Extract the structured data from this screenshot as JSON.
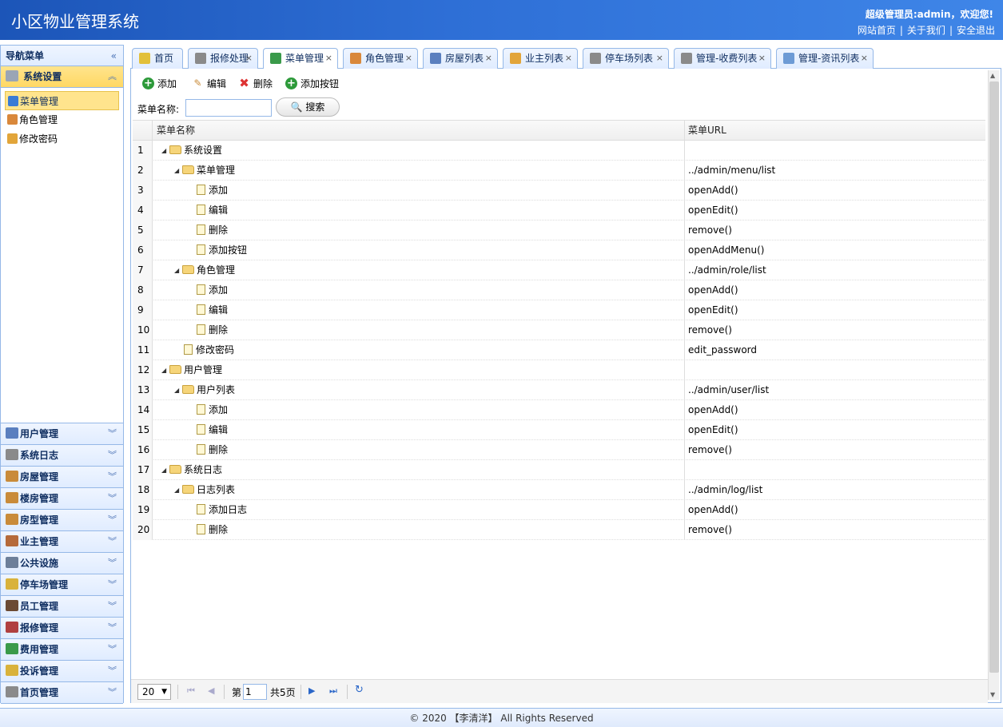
{
  "header": {
    "title": "小区物业管理系统",
    "welcome": "超级管理员:admin，欢迎您!",
    "links": [
      "网站首页",
      "关于我们",
      "安全退出"
    ]
  },
  "nav": {
    "title": "导航菜单",
    "active_group": "系统设置",
    "active_items": [
      {
        "label": "菜单管理",
        "icon": "tree-icon",
        "color": "#3a7bd5"
      },
      {
        "label": "角色管理",
        "icon": "users-icon",
        "color": "#d9883b"
      },
      {
        "label": "修改密码",
        "icon": "lock-icon",
        "color": "#e2a53a"
      }
    ],
    "groups": [
      {
        "label": "用户管理",
        "icon": "user-icon",
        "color": "#5a7fbf"
      },
      {
        "label": "系统日志",
        "icon": "log-icon",
        "color": "#8a8a8a"
      },
      {
        "label": "房屋管理",
        "icon": "house-icon",
        "color": "#c98b3a"
      },
      {
        "label": "楼房管理",
        "icon": "building-icon",
        "color": "#c98b3a"
      },
      {
        "label": "房型管理",
        "icon": "floorplan-icon",
        "color": "#c98b3a"
      },
      {
        "label": "业主管理",
        "icon": "owner-icon",
        "color": "#b56a3a"
      },
      {
        "label": "公共设施",
        "icon": "tools-icon",
        "color": "#6d7f99"
      },
      {
        "label": "停车场管理",
        "icon": "car-icon",
        "color": "#d9b23b"
      },
      {
        "label": "员工管理",
        "icon": "staff-icon",
        "color": "#6b4a33"
      },
      {
        "label": "报修管理",
        "icon": "wrench-icon",
        "color": "#b04040"
      },
      {
        "label": "费用管理",
        "icon": "money-icon",
        "color": "#3a9a4a"
      },
      {
        "label": "投诉管理",
        "icon": "complaint-icon",
        "color": "#d9b23b"
      },
      {
        "label": "首页管理",
        "icon": "home-icon",
        "color": "#8a8a8a"
      }
    ]
  },
  "tabs": [
    {
      "label": "首页",
      "icon": "bulb-icon",
      "color": "#e2c03a",
      "closable": false
    },
    {
      "label": "报修处理",
      "icon": "list-icon",
      "color": "#8a8a8a",
      "closable": true
    },
    {
      "label": "菜单管理",
      "icon": "tree-icon",
      "color": "#3a9a4a",
      "closable": true
    },
    {
      "label": "角色管理",
      "icon": "users-icon",
      "color": "#d9883b",
      "closable": true
    },
    {
      "label": "房屋列表",
      "icon": "house-icon",
      "color": "#5a7fbf",
      "closable": true
    },
    {
      "label": "业主列表",
      "icon": "owner-icon",
      "color": "#e2a53a",
      "closable": true
    },
    {
      "label": "停车场列表",
      "icon": "list-icon",
      "color": "#8a8a8a",
      "closable": true
    },
    {
      "label": "管理-收费列表",
      "icon": "list-icon",
      "color": "#8a8a8a",
      "closable": true
    },
    {
      "label": "管理-资讯列表",
      "icon": "chat-icon",
      "color": "#6d9bd5",
      "closable": true
    }
  ],
  "toolbar": {
    "add": "添加",
    "edit": "编辑",
    "delete": "删除",
    "add_button": "添加按钮"
  },
  "search": {
    "label": "菜单名称:",
    "value": "",
    "button": "搜索"
  },
  "grid": {
    "col_name": "菜单名称",
    "col_url": "菜单URL",
    "rows": [
      {
        "num": "1",
        "level": 0,
        "folder": true,
        "name": "系统设置",
        "url": ""
      },
      {
        "num": "2",
        "level": 1,
        "folder": true,
        "name": "菜单管理",
        "url": "../admin/menu/list"
      },
      {
        "num": "3",
        "level": 2,
        "folder": false,
        "name": "添加",
        "url": "openAdd()"
      },
      {
        "num": "4",
        "level": 2,
        "folder": false,
        "name": "编辑",
        "url": "openEdit()"
      },
      {
        "num": "5",
        "level": 2,
        "folder": false,
        "name": "删除",
        "url": "remove()"
      },
      {
        "num": "6",
        "level": 2,
        "folder": false,
        "name": "添加按钮",
        "url": "openAddMenu()"
      },
      {
        "num": "7",
        "level": 1,
        "folder": true,
        "name": "角色管理",
        "url": "../admin/role/list"
      },
      {
        "num": "8",
        "level": 2,
        "folder": false,
        "name": "添加",
        "url": "openAdd()"
      },
      {
        "num": "9",
        "level": 2,
        "folder": false,
        "name": "编辑",
        "url": "openEdit()"
      },
      {
        "num": "10",
        "level": 2,
        "folder": false,
        "name": "删除",
        "url": "remove()"
      },
      {
        "num": "11",
        "level": 1,
        "folder": false,
        "name": "修改密码",
        "url": "edit_password"
      },
      {
        "num": "12",
        "level": 0,
        "folder": true,
        "name": "用户管理",
        "url": ""
      },
      {
        "num": "13",
        "level": 1,
        "folder": true,
        "name": "用户列表",
        "url": "../admin/user/list"
      },
      {
        "num": "14",
        "level": 2,
        "folder": false,
        "name": "添加",
        "url": "openAdd()"
      },
      {
        "num": "15",
        "level": 2,
        "folder": false,
        "name": "编辑",
        "url": "openEdit()"
      },
      {
        "num": "16",
        "level": 2,
        "folder": false,
        "name": "删除",
        "url": "remove()"
      },
      {
        "num": "17",
        "level": 0,
        "folder": true,
        "name": "系统日志",
        "url": ""
      },
      {
        "num": "18",
        "level": 1,
        "folder": true,
        "name": "日志列表",
        "url": "../admin/log/list"
      },
      {
        "num": "19",
        "level": 2,
        "folder": false,
        "name": "添加日志",
        "url": "openAdd()"
      },
      {
        "num": "20",
        "level": 2,
        "folder": false,
        "name": "删除",
        "url": "remove()"
      }
    ]
  },
  "pager": {
    "page_size": "20",
    "page_prefix": "第",
    "page_value": "1",
    "total": "共5页"
  },
  "footer": "© 2020 【李清洋】 All Rights Reserved",
  "colors": {
    "header_blue": "#2e6fd6",
    "border_blue": "#95b8e7",
    "active_yellow": "#ffe48d"
  }
}
